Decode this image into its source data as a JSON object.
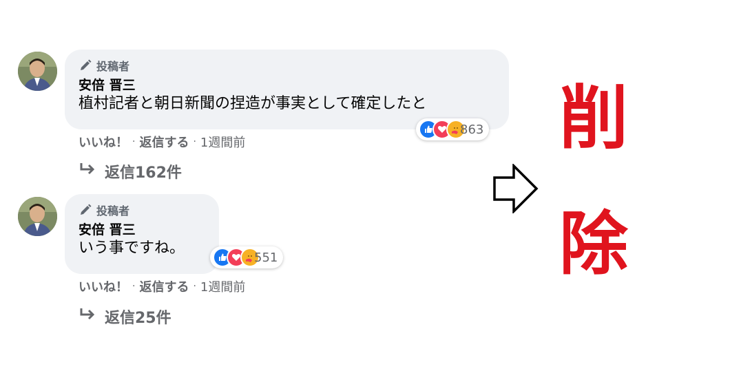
{
  "comments": [
    {
      "author_badge": "投稿者",
      "author_name": "安倍 晋三",
      "text": "植村記者と朝日新聞の捏造が事実として確定したと",
      "reaction_count": "863",
      "actions": {
        "like": "いいね！",
        "reply": "返信する",
        "time": "1週間前"
      },
      "replies_label": "返信162件"
    },
    {
      "author_badge": "投稿者",
      "author_name": "安倍 晋三",
      "text": "いう事ですね。",
      "reaction_count": "551",
      "actions": {
        "like": "いいね！",
        "reply": "返信する",
        "time": "1週間前"
      },
      "replies_label": "返信25件"
    }
  ],
  "deleted_label": {
    "char1": "削",
    "char2": "除"
  },
  "colors": {
    "bubble": "#f0f2f5",
    "deleted_red": "#e0141e",
    "like_blue": "#1877f2",
    "love_red": "#f33e58",
    "care_yellow": "#f7b125",
    "meta_gray": "#65676b"
  },
  "icons": {
    "author_badge": "pen-icon",
    "reply_arrow": "reply-arrow-icon",
    "reactions": [
      "like-icon",
      "love-icon",
      "care-icon"
    ],
    "between": "outline-right-arrow-icon"
  }
}
